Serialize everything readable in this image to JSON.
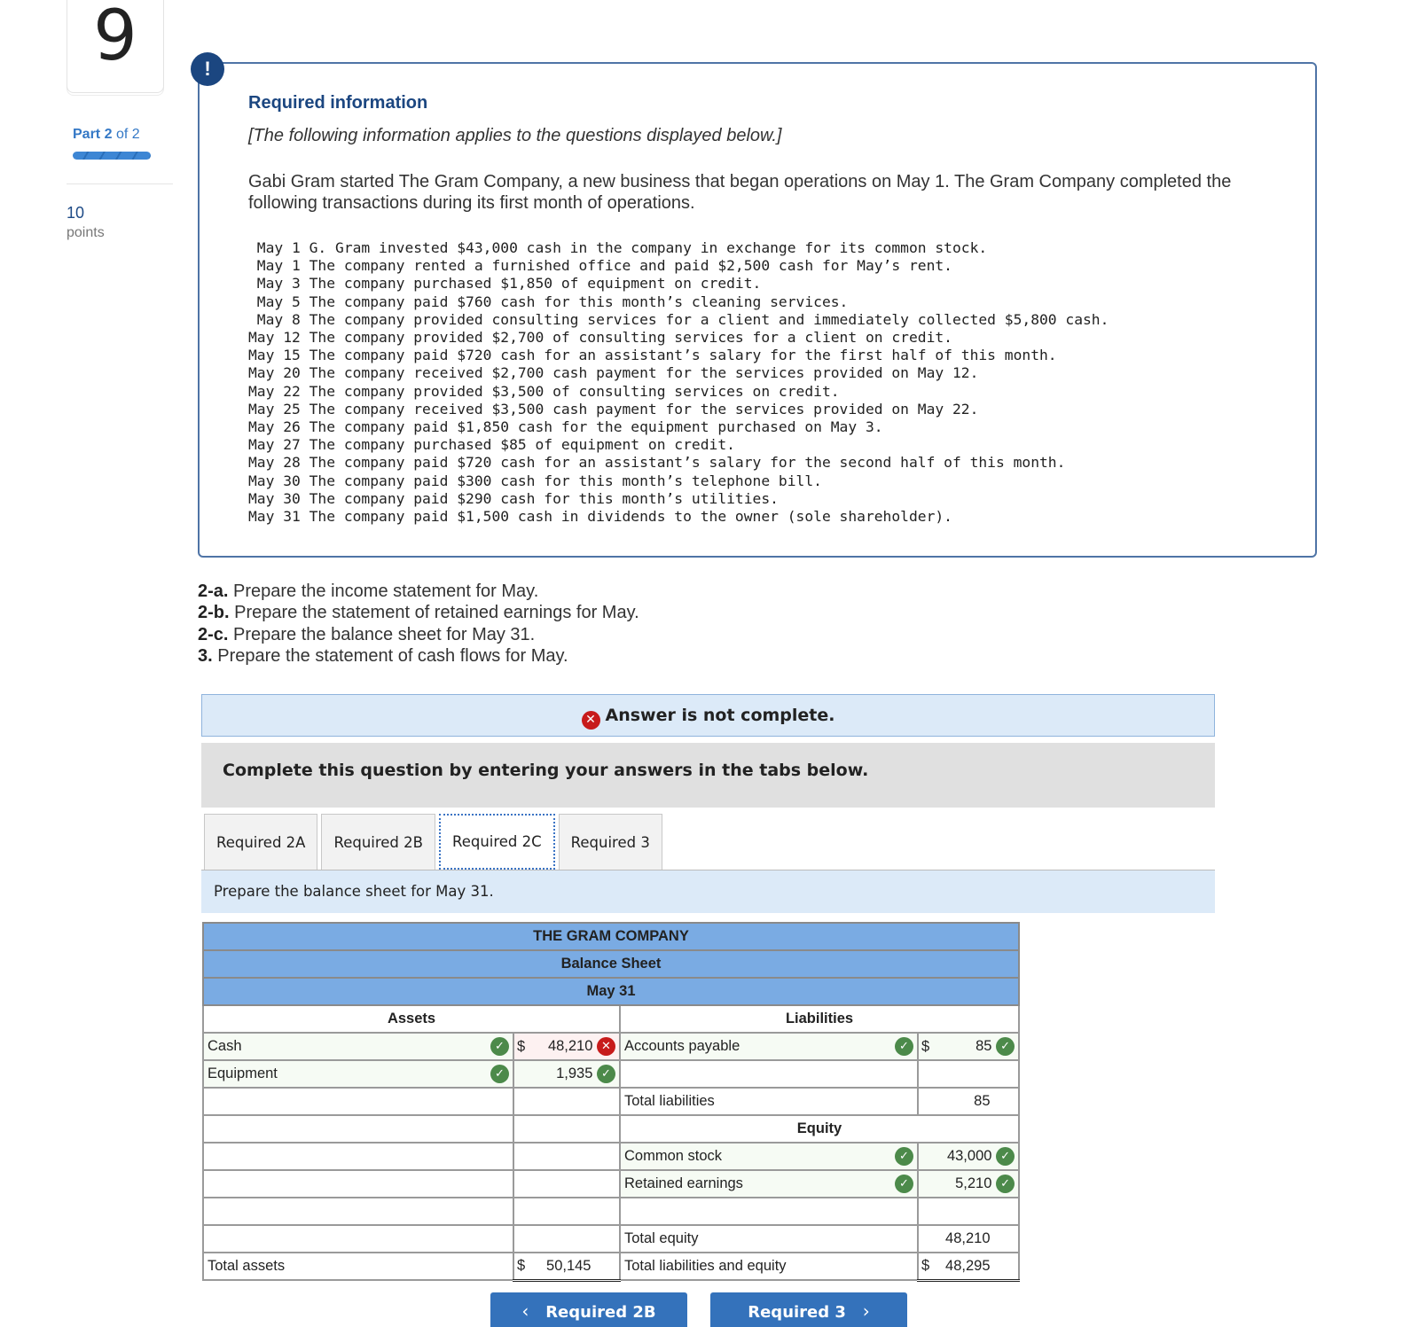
{
  "sidebar": {
    "question_number": "9",
    "part_prefix": "Part",
    "part_current": "2",
    "part_suffix": "of 2",
    "part_progress_fraction": 1.0,
    "points_value": "10",
    "points_label": "points"
  },
  "info": {
    "alert_icon": "exclamation-icon",
    "title": "Required information",
    "subtitle": "[The following information applies to the questions displayed below.]",
    "intro": "Gabi Gram started The Gram Company, a new business that began operations on May 1. The Gram Company completed the following transactions during its first month of operations.",
    "transactions": [
      " May 1 G. Gram invested $43,000 cash in the company in exchange for its common stock.",
      " May 1 The company rented a furnished office and paid $2,500 cash for May’s rent.",
      " May 3 The company purchased $1,850 of equipment on credit.",
      " May 5 The company paid $760 cash for this month’s cleaning services.",
      " May 8 The company provided consulting services for a client and immediately collected $5,800 cash.",
      "May 12 The company provided $2,700 of consulting services for a client on credit.",
      "May 15 The company paid $720 cash for an assistant’s salary for the first half of this month.",
      "May 20 The company received $2,700 cash payment for the services provided on May 12.",
      "May 22 The company provided $3,500 of consulting services on credit.",
      "May 25 The company received $3,500 cash payment for the services provided on May 22.",
      "May 26 The company paid $1,850 cash for the equipment purchased on May 3.",
      "May 27 The company purchased $85 of equipment on credit.",
      "May 28 The company paid $720 cash for an assistant’s salary for the second half of this month.",
      "May 30 The company paid $300 cash for this month’s telephone bill.",
      "May 30 The company paid $290 cash for this month’s utilities.",
      "May 31 The company paid $1,500 cash in dividends to the owner (sole shareholder)."
    ]
  },
  "requirements": [
    {
      "num": "2-a.",
      "text": " Prepare the income statement for May."
    },
    {
      "num": "2-b.",
      "text": " Prepare the statement of retained earnings for May."
    },
    {
      "num": "2-c.",
      "text": " Prepare the balance sheet for May 31."
    },
    {
      "num": "3.",
      "text": " Prepare the statement of cash flows for May."
    }
  ],
  "status": {
    "icon": "x-circle-icon",
    "message": "Answer is not complete.",
    "instruction": "Complete this question by entering your answers in the tabs below."
  },
  "tabs": [
    {
      "label": "Required 2A",
      "active": false
    },
    {
      "label": "Required 2B",
      "active": false
    },
    {
      "label": "Required 2C",
      "active": true
    },
    {
      "label": "Required 3",
      "active": false
    }
  ],
  "prompt": "Prepare the balance sheet for May 31.",
  "balance_sheet": {
    "company": "THE GRAM COMPANY",
    "title": "Balance Sheet",
    "date": "May 31",
    "assets_header": "Assets",
    "liabilities_header": "Liabilities",
    "equity_header": "Equity",
    "currency": "$",
    "assets": [
      {
        "label": "Cash",
        "label_status": "correct",
        "value": "48,210",
        "value_status": "incorrect"
      },
      {
        "label": "Equipment",
        "label_status": "correct",
        "value": "1,935",
        "value_status": "correct"
      }
    ],
    "liabilities": [
      {
        "label": "Accounts payable",
        "label_status": "correct",
        "value": "85",
        "value_status": "correct"
      }
    ],
    "total_liabilities_label": "Total liabilities",
    "total_liabilities_value": "85",
    "equity": [
      {
        "label": "Common stock",
        "label_status": "correct",
        "value": "43,000",
        "value_status": "correct"
      },
      {
        "label": "Retained earnings",
        "label_status": "correct",
        "value": "5,210",
        "value_status": "correct"
      }
    ],
    "total_equity_label": "Total equity",
    "total_equity_value": "48,210",
    "total_assets_label": "Total assets",
    "total_assets_value": "50,145",
    "total_liab_equity_label": "Total liabilities and equity",
    "total_liab_equity_value": "48,295"
  },
  "navigation": {
    "prev_label": "Required 2B",
    "next_label": "Required 3",
    "prev_icon": "chevron-left-icon",
    "next_icon": "chevron-right-icon"
  },
  "colors": {
    "brand_navy": "#1b4680",
    "header_blue": "#7aabe3",
    "button_blue": "#3472bb",
    "correct_green": "#4c8a4a",
    "incorrect_red": "#c71b1b"
  }
}
